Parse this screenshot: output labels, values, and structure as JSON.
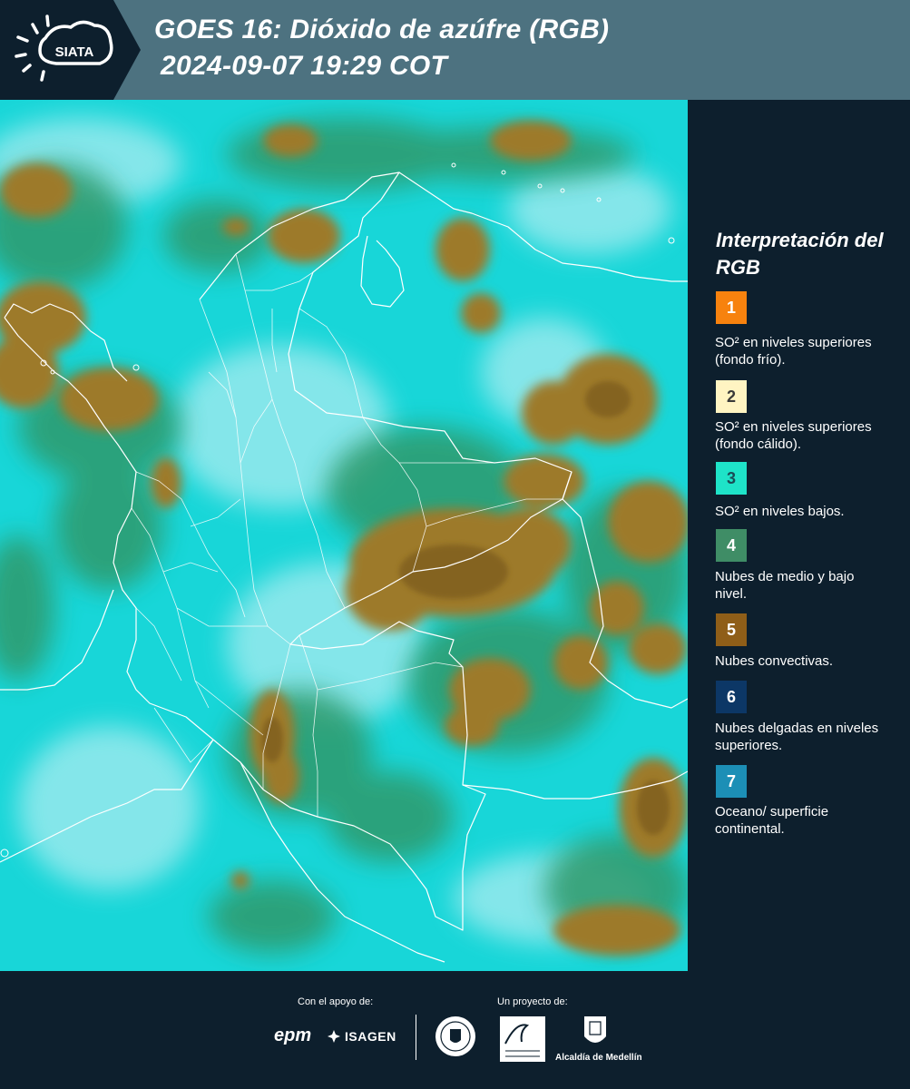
{
  "header": {
    "logo_text": "SIATA",
    "title_line1": "GOES 16: Dióxido de azúfre (RGB)",
    "title_line2": "2024-09-07 19:29 COT"
  },
  "map": {
    "product": "GOES 16 SO2 RGB composite",
    "colors": {
      "background": "#18d6d8",
      "light_cloud": "#a9ecf0",
      "green": "#2f9a6c",
      "convective": "#9d7a2c"
    }
  },
  "legend": {
    "title": "Interpretación del RGB",
    "items": [
      {
        "number": "1",
        "color": "#f7820e",
        "text_color": "#ffffff",
        "label": "SO² en niveles superiores (fondo frío)."
      },
      {
        "number": "2",
        "color": "#fff4c2",
        "text_color": "#3a3a3a",
        "label": "SO² en niveles superiores (fondo cálido)."
      },
      {
        "number": "3",
        "color": "#1ee3c8",
        "text_color": "#1b4a55",
        "label": "SO² en niveles bajos."
      },
      {
        "number": "4",
        "color": "#3f8d66",
        "text_color": "#ffffff",
        "label": "Nubes de medio y bajo nivel."
      },
      {
        "number": "5",
        "color": "#8f5e18",
        "text_color": "#ffffff",
        "label": "Nubes convectivas."
      },
      {
        "number": "6",
        "color": "#0c3766",
        "text_color": "#ffffff",
        "label": "Nubes delgadas en niveles superiores."
      },
      {
        "number": "7",
        "color": "#1c8fb6",
        "text_color": "#ffffff",
        "label": "Oceano/ superficie continental."
      }
    ]
  },
  "footer": {
    "support_label": "Con el apoyo de:",
    "project_label": "Un proyecto de:",
    "sponsor_epm": "epm",
    "sponsor_isagen": "ISAGEN",
    "partner_medellin_seal": "Medellín",
    "partner_area_metropolitana": "Area Metropolitana Valle de Aburrá",
    "partner_alcaldia": "Alcaldía de Medellín"
  }
}
